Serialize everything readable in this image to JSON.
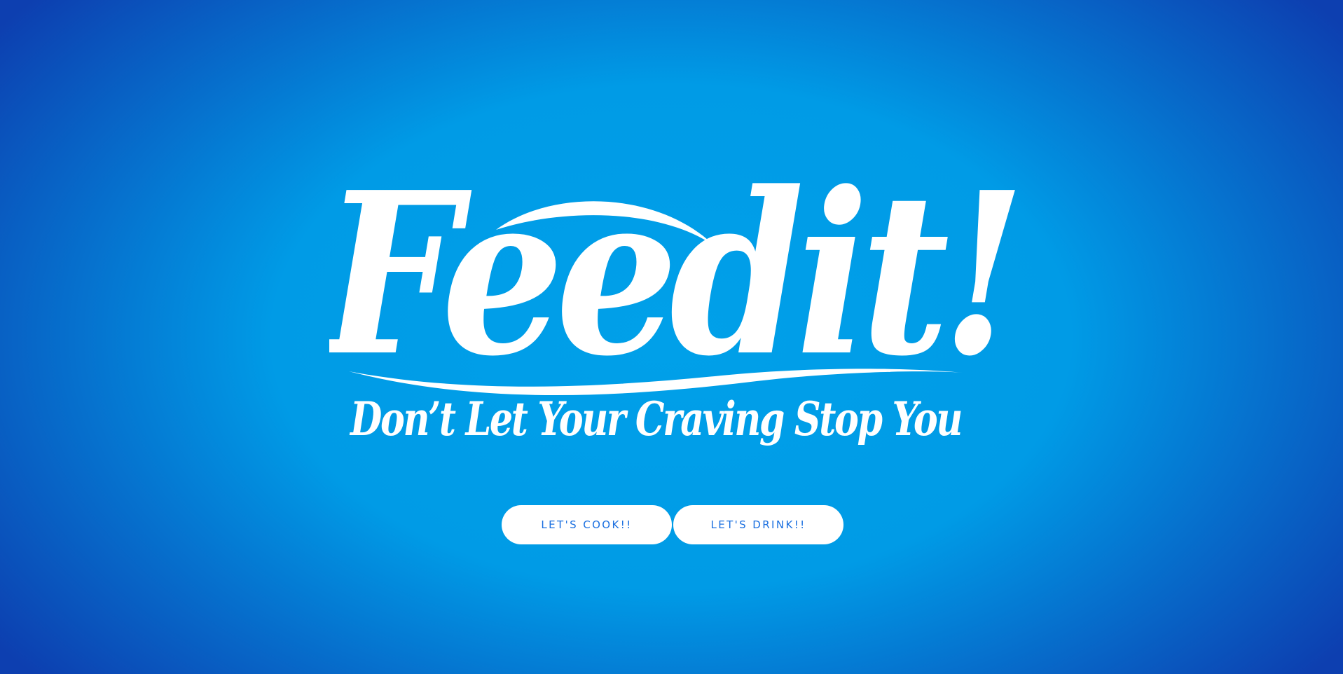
{
  "logo": {
    "wordmark": "Feedit!",
    "tagline": "Don’t Let Your Craving Stop You",
    "color": "#ffffff"
  },
  "actions": {
    "cook_label": "LET'S COOK!!",
    "drink_label": "LET'S DRINK!!"
  },
  "theme": {
    "background_center": "#00a0e9",
    "background_edge": "#0d3fb0",
    "button_text": "#1a6fe0"
  }
}
